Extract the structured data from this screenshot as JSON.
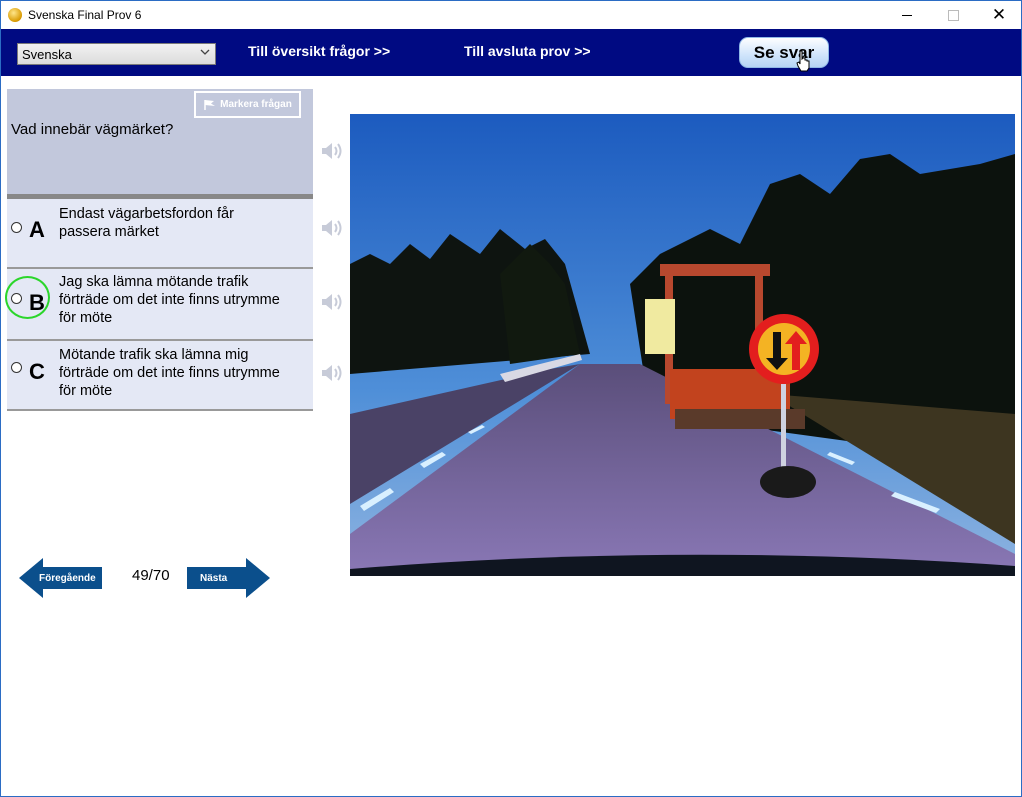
{
  "window": {
    "title": "Svenska Final Prov 6"
  },
  "toolbar": {
    "language": "Svenska",
    "overview_link": "Till översikt frågor >>",
    "finish_link": "Till avsluta prov  >>",
    "show_answer": "Se svar"
  },
  "question": {
    "mark_label": "Markera frågan",
    "text": "Vad innebär vägmärket?",
    "answers": [
      {
        "letter": "A",
        "text": "Endast vägarbetsfordon får passera märket"
      },
      {
        "letter": "B",
        "text": "Jag ska lämna mötande trafik förträde om det inte finns utrymme för möte"
      },
      {
        "letter": "C",
        "text": "Mötande trafik ska lämna mig förträde om det inte finns utrymme för möte"
      }
    ]
  },
  "navigation": {
    "prev_label": "Föregående",
    "next_label": "Nästa",
    "counter": "49/70"
  },
  "colors": {
    "topbar": "#000a82",
    "question_bg": "#c2c8dc",
    "answer_bg": "#e4e8f5",
    "arrow": "#0b4f8c",
    "highlight_ring": "#2bd62b"
  }
}
